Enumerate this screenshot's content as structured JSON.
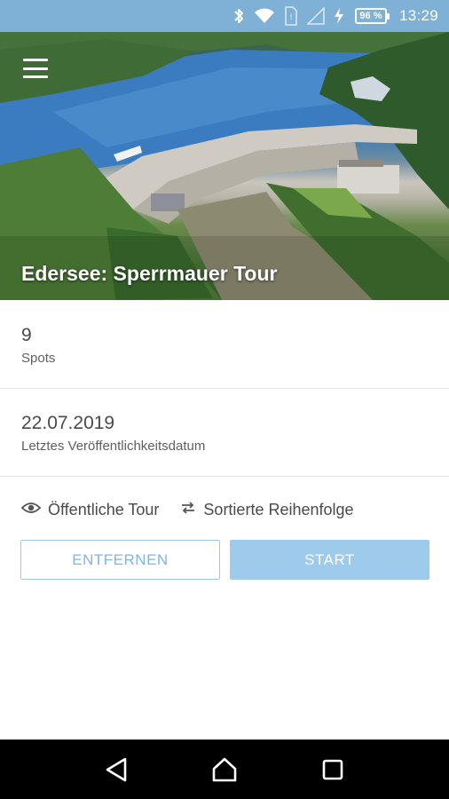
{
  "status_bar": {
    "battery": "96 %",
    "time": "13:29",
    "icons": [
      "bluetooth-icon",
      "wifi-icon",
      "sim-icon",
      "signal-icon",
      "charging-icon",
      "battery-icon"
    ]
  },
  "hero": {
    "menu_icon": "hamburger-menu-icon",
    "title": "Edersee: Sperrmauer Tour"
  },
  "spots": {
    "value": "9",
    "label": "Spots"
  },
  "published": {
    "value": "22.07.2019",
    "label": "Letztes Veröffentlichkeitsdatum"
  },
  "meta": {
    "visibility_icon": "eye-icon",
    "visibility_label": "Öffentliche Tour",
    "order_icon": "swap-arrows-icon",
    "order_label": "Sortierte Reihenfolge"
  },
  "actions": {
    "remove_label": "ENTFERNEN",
    "start_label": "START"
  },
  "navigation": {
    "back_icon": "back-triangle-icon",
    "home_icon": "home-icon",
    "recents_icon": "recents-square-icon"
  },
  "colors": {
    "status_bar": "#7fb0d6",
    "accent": "#9ecaec",
    "accent_outline": "#9ec8e8",
    "text": "#4a4a4a"
  }
}
